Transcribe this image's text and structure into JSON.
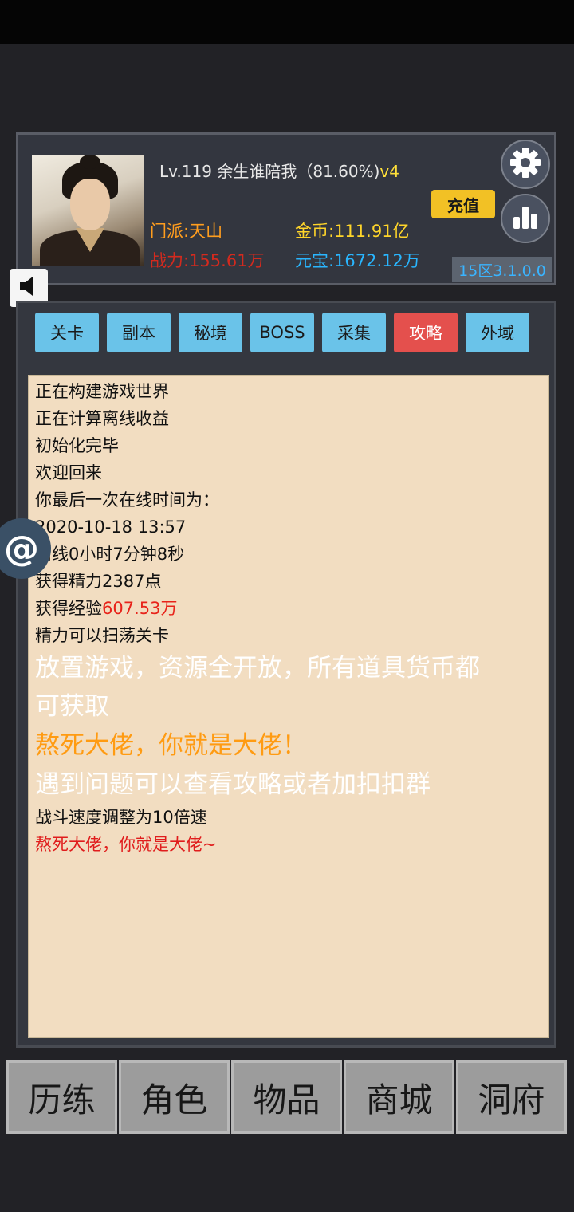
{
  "header": {
    "level_name": "Lv.119 余生谁陪我（81.60%)",
    "vip": "v4",
    "sect": "门派:天山",
    "power": "战力:155.61万",
    "gold": "金币:111.91亿",
    "yuanbao": "元宝:1672.12万",
    "recharge": "充值",
    "version": "15区3.1.0.0",
    "settings_icon": "gear-icon",
    "stats_icon": "bar-chart-icon"
  },
  "tabs": [
    {
      "label": "关卡",
      "active": false
    },
    {
      "label": "副本",
      "active": false
    },
    {
      "label": "秘境",
      "active": false
    },
    {
      "label": "BOSS",
      "active": false
    },
    {
      "label": "采集",
      "active": false
    },
    {
      "label": "攻略",
      "active": true
    },
    {
      "label": "外域",
      "active": false
    }
  ],
  "log": {
    "l1": "正在构建游戏世界",
    "l2": "正在计算离线收益",
    "l3": "初始化完毕",
    "l4": "欢迎回来",
    "l5": "你最后一次在线时间为：",
    "l6": "2020-10-18 13:57",
    "l7": "离线0小时7分钟8秒",
    "l8": "获得精力2387点",
    "l9_prefix": "获得经验",
    "l9_value": "607.53万",
    "l10": "精力可以扫荡关卡",
    "l11": "放置游戏，资源全开放，所有道具货币都",
    "l12": "可获取",
    "l13": "熬死大佬，你就是大佬！",
    "l14": "遇到问题可以查看攻略或者加扣扣群",
    "l15": "战斗速度调整为10倍速",
    "l16": "熬死大佬，你就是大佬~"
  },
  "side": {
    "sound_icon": "speaker-icon",
    "at_label": "@"
  },
  "bottom_nav": [
    "历练",
    "角色",
    "物品",
    "商城",
    "洞府"
  ],
  "colors": {
    "accent_tab": "#6ac3e9",
    "active_tab": "#e4504d",
    "log_bg": "#f2ddc1",
    "gold": "#ffd52a",
    "yuanbao": "#29b6ff",
    "sect": "#ff9d1e",
    "power": "#d42a1e"
  }
}
